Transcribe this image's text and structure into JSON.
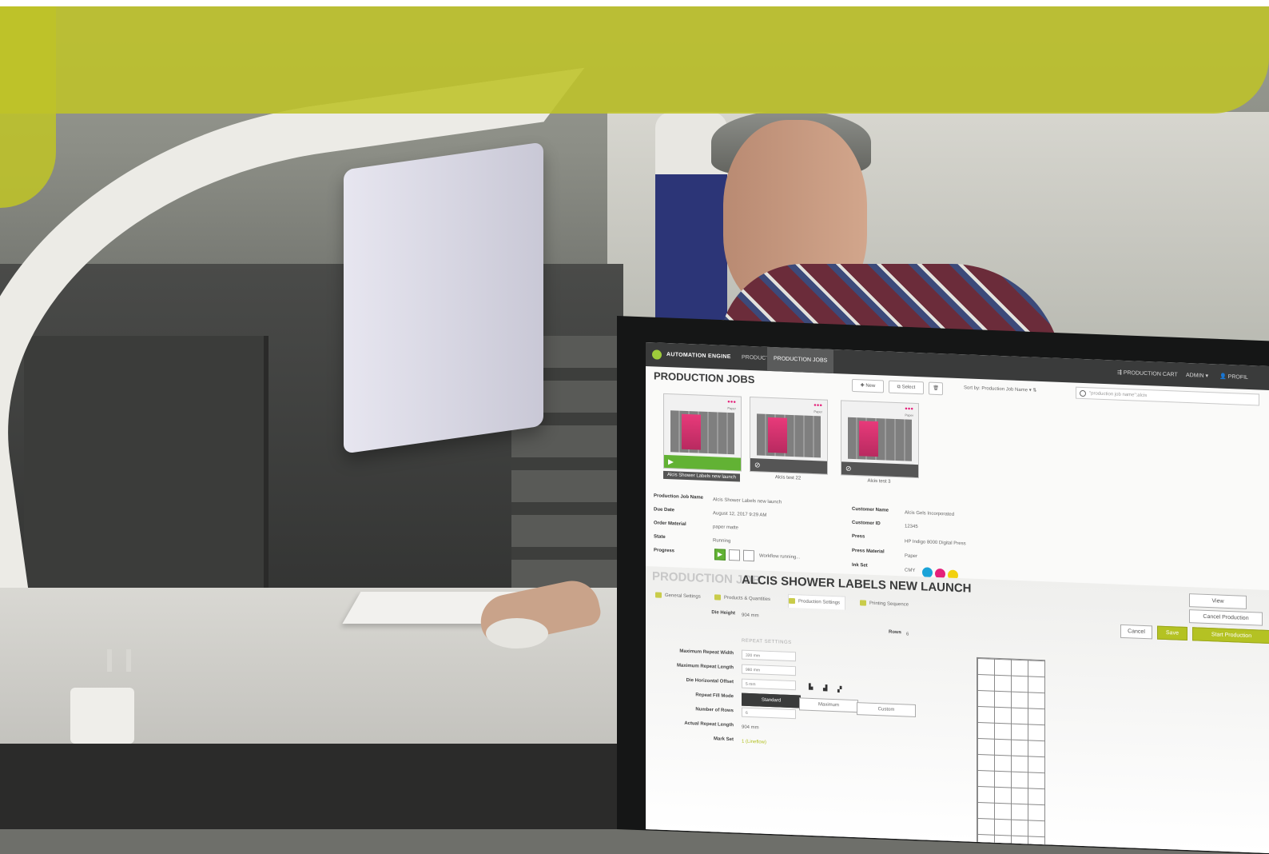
{
  "app": {
    "name": "AUTOMATION ENGINE",
    "nav_tabs": [
      "PRODUCTS",
      "PRODUCTION JOBS"
    ],
    "active_tab": 1,
    "cart_label": "PRODUCTION CART",
    "admin_label": "ADMIN",
    "profile_label": "PROFIL"
  },
  "toolbar": {
    "page_title": "PRODUCTION JOBS",
    "new_label": "New",
    "select_label": "Select",
    "sort_label": "Sort by: Production Job Name",
    "search_placeholder": "\"production job name\":alcis"
  },
  "jobs": [
    {
      "name": "Alcis Shower Labels new launch",
      "state": "running",
      "media": "Paper"
    },
    {
      "name": "Alcis test 22",
      "state": "stopped",
      "media": "Paper"
    },
    {
      "name": "Alcis test 3",
      "state": "stopped",
      "media": "Paper"
    }
  ],
  "details": {
    "left": [
      {
        "label": "Production Job Name",
        "value": "Alcis Shower Labels new launch"
      },
      {
        "label": "Due Date",
        "value": "August 12, 2017 9:29 AM"
      },
      {
        "label": "Order Material",
        "value": "paper matte"
      },
      {
        "label": "State",
        "value": "Running"
      },
      {
        "label": "Progress",
        "value": "Workflow running..."
      }
    ],
    "right": [
      {
        "label": "Customer Name",
        "value": "Alcis Gels Incorporated"
      },
      {
        "label": "Customer ID",
        "value": "12345"
      },
      {
        "label": "Press",
        "value": "HP Indigo 8000 Digital Press"
      },
      {
        "label": "Press Material",
        "value": "Paper"
      },
      {
        "label": "Ink Set",
        "value": "CMY"
      }
    ],
    "ink_colors": [
      "#1aa3d8",
      "#e4217a",
      "#f2d10f"
    ]
  },
  "production_job": {
    "label": "PRODUCTION JOB",
    "name": "ALCIS SHOWER LABELS NEW LAUNCH",
    "tabs": [
      "General Settings",
      "Products & Quantities",
      "Production Settings",
      "Printing Sequence"
    ],
    "active_tab": 2,
    "view_label": "View",
    "cancel_production_label": "Cancel Production",
    "cancel_label": "Cancel",
    "save_label": "Save",
    "start_label": "Start Production"
  },
  "settings": {
    "die_height_label": "Die Height",
    "die_height_value": "904 mm",
    "rows_label": "Rows",
    "rows_value": "6",
    "section_title": "REPEAT SETTINGS",
    "fields": [
      {
        "label": "Maximum Repeat Width",
        "value": "320 mm"
      },
      {
        "label": "Maximum Repeat Length",
        "value": "980 mm"
      },
      {
        "label": "Die Horizontal Offset",
        "value": "5 mm"
      },
      {
        "label": "Repeat Fill Mode",
        "value": ""
      },
      {
        "label": "Number of Rows",
        "value": "6"
      },
      {
        "label": "Actual Repeat Length",
        "value": "904 mm"
      },
      {
        "label": "Mark Set",
        "value": "1 (Lineflow)"
      }
    ],
    "fill_modes": [
      "Standard",
      "Maximum",
      "Custom"
    ],
    "active_fill_mode": 0
  },
  "colors": {
    "brand_yellow": "#bec328",
    "running_green": "#62b234",
    "save_green": "#b4c223"
  }
}
